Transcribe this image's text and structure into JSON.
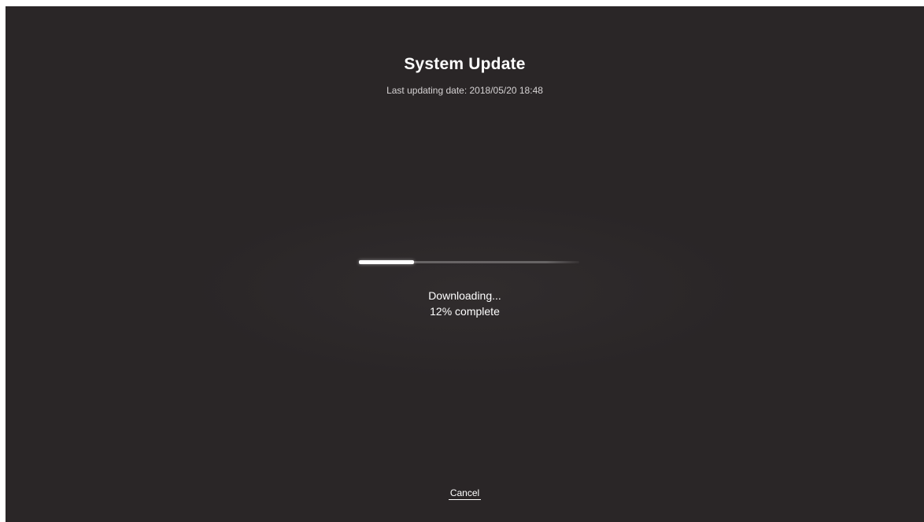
{
  "header": {
    "title": "System Update",
    "last_updated": "Last updating date: 2018/05/20 18:48"
  },
  "progress": {
    "fraction": 0.25,
    "status_line": "Downloading...",
    "percent_line": "12% complete"
  },
  "actions": {
    "cancel_label": "Cancel"
  },
  "colors": {
    "background": "#2a2627",
    "text": "#ffffff",
    "progress_fill": "#ffffff",
    "progress_track": "#969394"
  }
}
